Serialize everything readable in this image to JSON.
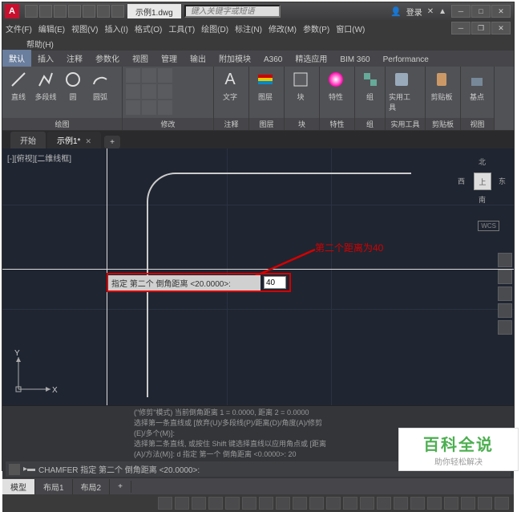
{
  "title": {
    "filename": "示例1.dwg",
    "search_placeholder": "键入关键字或短语",
    "signin": "登录"
  },
  "menus": {
    "file": "文件(F)",
    "edit": "编辑(E)",
    "view": "视图(V)",
    "insert": "插入(I)",
    "format": "格式(O)",
    "tools": "工具(T)",
    "draw": "绘图(D)",
    "dimension": "标注(N)",
    "modify": "修改(M)",
    "param": "参数(P)",
    "window": "窗口(W)",
    "help": "帮助(H)"
  },
  "ribbon_tabs": {
    "default": "默认",
    "insert": "插入",
    "annotate": "注释",
    "param": "参数化",
    "view": "视图",
    "manage": "管理",
    "output": "输出",
    "addins": "附加模块",
    "a360": "A360",
    "featured": "精选应用",
    "bim360": "BIM 360",
    "performance": "Performance"
  },
  "panels": {
    "draw": {
      "line": "直线",
      "polyline": "多段线",
      "circle": "圆",
      "arc": "圆弧",
      "label": "绘图"
    },
    "modify": {
      "label": "修改"
    },
    "annotate": {
      "text": "文字",
      "label": "注释"
    },
    "layer": {
      "name": "图层",
      "label": "图层"
    },
    "block": {
      "name": "块",
      "label": "块"
    },
    "props": {
      "name": "特性",
      "label": "特性"
    },
    "group": {
      "name": "组",
      "label": "组"
    },
    "util": {
      "name": "实用工具",
      "label": "实用工具"
    },
    "clip": {
      "name": "剪贴板",
      "label": "剪贴板"
    },
    "viewbase": {
      "name": "基点",
      "label": "视图"
    }
  },
  "doc_tabs": {
    "start": "开始",
    "doc1": "示例1*"
  },
  "viewport": {
    "label": "[-][俯视][二维线框]"
  },
  "viewcube": {
    "top": "上",
    "n": "北",
    "s": "南",
    "e": "东",
    "w": "西",
    "wcs": "WCS"
  },
  "annotation": "第二个距离为40",
  "prompt": {
    "label": "指定 第二个 倒角距离 <20.0000>:",
    "value": "40"
  },
  "cmd": {
    "h1": "(\"修剪\"模式) 当前倒角距离 1 = 0.0000, 距离 2 = 0.0000",
    "h2": "选择第一条直线或 [放弃(U)/多段线(P)/距离(D)/角度(A)/修剪",
    "h3": "(E)/多个(M)]:",
    "h4": "选择第二条直线, 或按住 Shift 键选择直线以应用角点或 [距离",
    "h5": "(A)/方法(M)]: d 指定 第一个 倒角距离 <0.0000>: 20",
    "current": "CHAMFER 指定 第二个 倒角距离 <20.0000>:"
  },
  "model_tabs": {
    "model": "模型",
    "layout1": "布局1",
    "layout2": "布局2"
  },
  "ucs": {
    "x": "X",
    "y": "Y"
  },
  "watermark": {
    "title": "百科全说",
    "sub": "助你轻松解决"
  }
}
